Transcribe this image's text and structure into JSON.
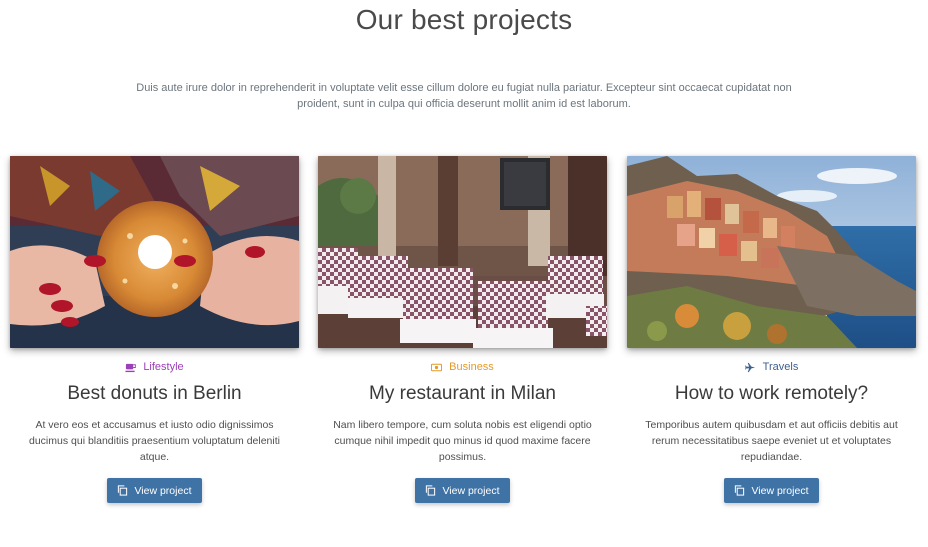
{
  "header": {
    "title": "Our best projects",
    "lead": "Duis aute irure dolor in reprehenderit in voluptate velit esse cillum dolore eu fugiat nulla pariatur. Excepteur sint occaecat cupidatat non proident, sunt in culpa qui officia deserunt mollit anim id est laborum."
  },
  "cards": [
    {
      "category": "Lifestyle",
      "category_icon": "coffee-cup-icon",
      "category_color": "#9b40b6",
      "image": "donut-photo",
      "title": "Best donuts in Berlin",
      "text": "At vero eos et accusamus et iusto odio dignissimos ducimus qui blanditiis praesentium voluptatum deleniti atque.",
      "button": "View project"
    },
    {
      "category": "Business",
      "category_icon": "money-bill-icon",
      "category_color": "#e49a2a",
      "image": "restaurant-photo",
      "title": "My restaurant in Milan",
      "text": "Nam libero tempore, cum soluta nobis est eligendi optio cumque nihil impedit quo minus id quod maxime facere possimus.",
      "button": "View project"
    },
    {
      "category": "Travels",
      "category_icon": "plane-icon",
      "category_color": "#3f5f8f",
      "image": "coastal-village-photo",
      "title": "How to work remotely?",
      "text": "Temporibus autem quibusdam et aut officiis debitis aut rerum necessitatibus saepe eveniet ut et voluptates repudiandae.",
      "button": "View project"
    }
  ],
  "colors": {
    "button": "#3f73a6"
  }
}
